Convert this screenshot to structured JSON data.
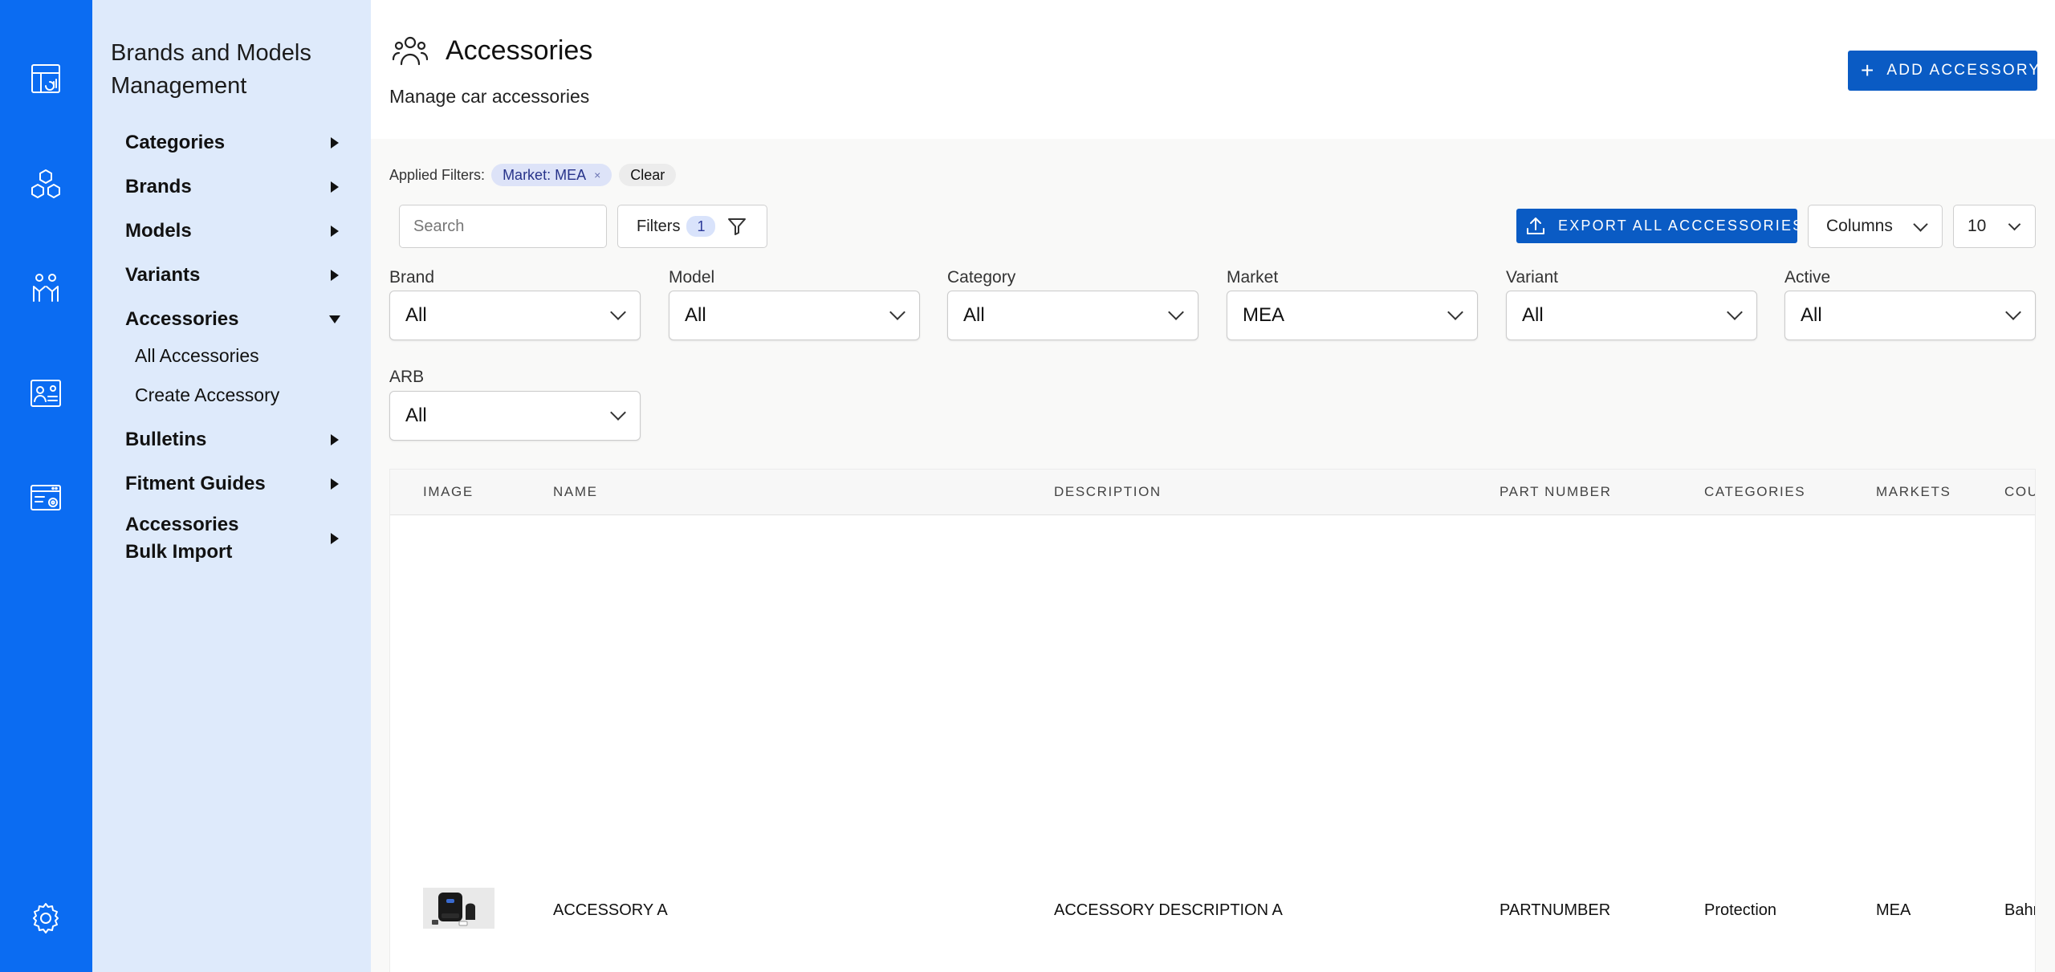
{
  "rail": {
    "items": [
      "dashboard-icon",
      "hexagons-icon",
      "users-icon",
      "user-settings-icon",
      "window-settings-icon",
      "settings-icon"
    ]
  },
  "sidebar": {
    "title": "Brands and Models Management",
    "items": [
      {
        "label": "Categories",
        "expanded": false
      },
      {
        "label": "Brands",
        "expanded": false
      },
      {
        "label": "Models",
        "expanded": false
      },
      {
        "label": "Variants",
        "expanded": false
      },
      {
        "label": "Accessories",
        "expanded": true
      },
      {
        "label": "Bulletins",
        "expanded": false
      },
      {
        "label": "Fitment Guides",
        "expanded": false
      },
      {
        "label": "Accessories Bulk Import",
        "expanded": false
      }
    ],
    "accessories_sub": [
      "All Accessories",
      "Create Accessory"
    ]
  },
  "header": {
    "title": "Accessories",
    "subtitle": "Manage car accessories",
    "add_button": "ADD ACCESSORY"
  },
  "applied_filters": {
    "label": "Applied Filters:",
    "chips": [
      "Market: MEA"
    ],
    "clear": "Clear"
  },
  "toolbar": {
    "search_placeholder": "Search",
    "filters_label": "Filters",
    "filters_count": "1",
    "export_label": "EXPORT ALL ACCCESSORIES",
    "columns_label": "Columns",
    "page_size": "10"
  },
  "filters": [
    {
      "label": "Brand",
      "value": "All"
    },
    {
      "label": "Model",
      "value": "All"
    },
    {
      "label": "Category",
      "value": "All"
    },
    {
      "label": "Market",
      "value": "MEA"
    },
    {
      "label": "Variant",
      "value": "All"
    },
    {
      "label": "Active",
      "value": "All"
    },
    {
      "label": "ARB",
      "value": "All"
    }
  ],
  "table": {
    "columns": [
      "IMAGE",
      "NAME",
      "DESCRIPTION",
      "PART NUMBER",
      "CATEGORIES",
      "MARKETS",
      "COU"
    ],
    "rows": [
      {
        "name": "ACCESSORY A",
        "description": "ACCESSORY DESCRIPTION A",
        "part_number": "PARTNUMBER",
        "categories": "Protection",
        "markets": "MEA",
        "country": "Bahr"
      }
    ]
  },
  "colors": {
    "rail": "#0b6cf2",
    "subnav": "#deeafb",
    "primary_button": "#0a5bc4"
  }
}
